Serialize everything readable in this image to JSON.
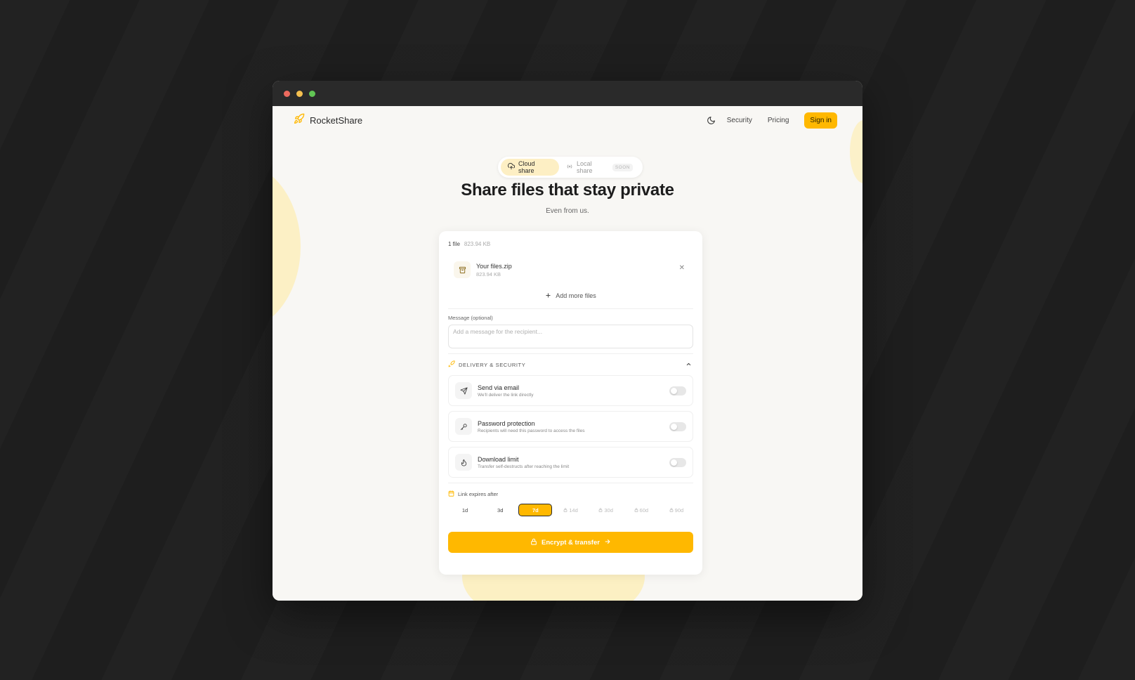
{
  "app": {
    "brand_name": "RocketShare"
  },
  "nav": {
    "links": [
      "Security",
      "Pricing"
    ],
    "signin_label": "Sign in"
  },
  "mode_tabs": {
    "cloud_label": "Cloud share",
    "local_label": "Local share",
    "local_badge": "SOON"
  },
  "hero": {
    "title": "Share files that stay private",
    "subtitle": "Even from us."
  },
  "upload": {
    "file_count": "1 file",
    "total_size": "823.94 KB",
    "file": {
      "name": "Your files.zip",
      "size": "823.94 KB"
    },
    "add_more_label": "Add more files"
  },
  "message": {
    "label": "Message (optional)",
    "placeholder": "Add a message for the recipient..."
  },
  "delivery": {
    "section_title": "DELIVERY & SECURITY",
    "options": [
      {
        "title": "Send via email",
        "subtitle": "We'll deliver the link directly",
        "icon": "send-icon",
        "enabled": false
      },
      {
        "title": "Password protection",
        "subtitle": "Recipients will need this password to access the files",
        "icon": "key-icon",
        "enabled": false
      },
      {
        "title": "Download limit",
        "subtitle": "Transfer self-destructs after reaching the limit",
        "icon": "flame-icon",
        "enabled": false
      }
    ]
  },
  "expiry": {
    "label": "Link expires after",
    "options": [
      {
        "label": "1d",
        "locked": false
      },
      {
        "label": "3d",
        "locked": false
      },
      {
        "label": "7d",
        "locked": false,
        "selected": true
      },
      {
        "label": "14d",
        "locked": true
      },
      {
        "label": "30d",
        "locked": true
      },
      {
        "label": "60d",
        "locked": true
      },
      {
        "label": "90d",
        "locked": true
      }
    ]
  },
  "cta": {
    "label": "Encrypt & transfer"
  },
  "colors": {
    "accent": "#ffb800",
    "accent_soft": "#fdefc4",
    "page_bg": "#f8f7f4",
    "desktop_bg": "#1f1f1f"
  }
}
